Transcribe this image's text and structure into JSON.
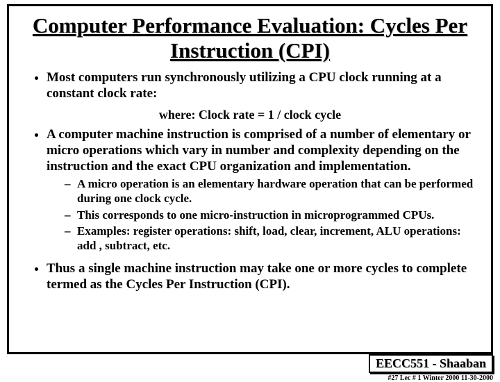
{
  "title": "Computer Performance Evaluation: Cycles Per Instruction (CPI)",
  "bullets": {
    "b1": "Most computers run synchronously utilizing a CPU clock running at a constant clock rate:",
    "formula": "where:   Clock rate  =  1 / clock cycle",
    "b2": "A computer machine instruction is comprised of a number of elementary or micro operations which vary in number and complexity depending on the instruction and the exact CPU organization and implementation.",
    "sub1": "A micro operation is an elementary hardware operation that can be performed during one clock cycle.",
    "sub2": "This corresponds to one micro-instruction in microprogrammed CPUs.",
    "sub3": "Examples:  register operations: shift, load, clear, increment, ALU operations: add , subtract, etc.",
    "b3": "Thus a single machine instruction may take one or more cycles to complete termed as the Cycles Per Instruction (CPI)."
  },
  "footer": {
    "course": "EECC551 - Shaaban",
    "meta": "#27  Lec # 1  Winter 2000   11-30-2000"
  }
}
